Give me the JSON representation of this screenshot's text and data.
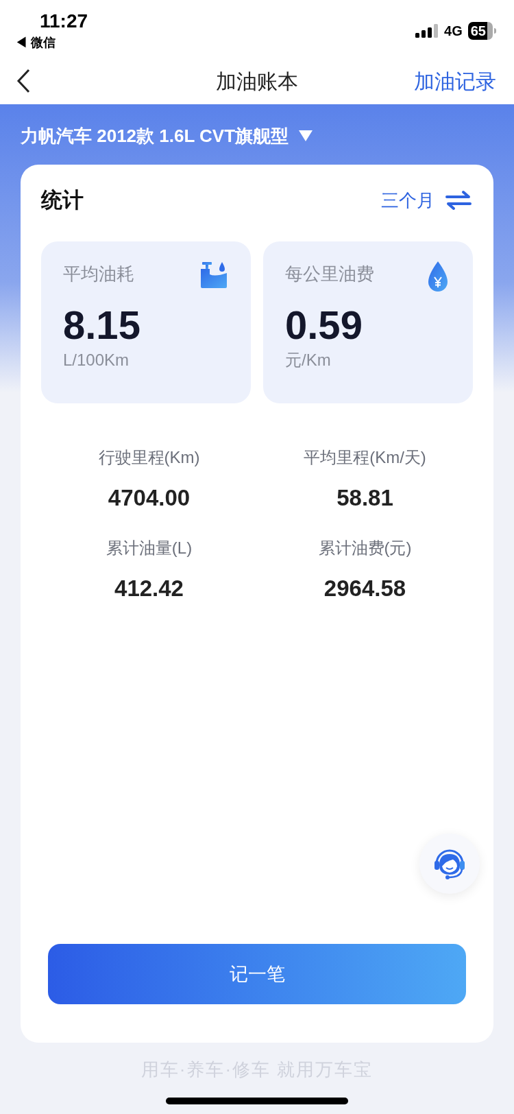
{
  "status_bar": {
    "time": "11:27",
    "back_app": "◀ 微信",
    "network": "4G",
    "battery": "65"
  },
  "nav": {
    "title": "加油账本",
    "action": "加油记录"
  },
  "car_selector": {
    "label": "力帆汽车 2012款 1.6L CVT旗舰型"
  },
  "stats": {
    "title": "统计",
    "period": "三个月",
    "highlights": [
      {
        "kind": "tank",
        "label": "平均油耗",
        "value": "8.15",
        "unit": "L/100Km"
      },
      {
        "kind": "drop",
        "label": "每公里油费",
        "value": "0.59",
        "unit": "元/Km"
      }
    ],
    "metrics": [
      {
        "label": "行驶里程(Km)",
        "value": "4704.00"
      },
      {
        "label": "平均里程(Km/天)",
        "value": "58.81"
      },
      {
        "label": "累计油量(L)",
        "value": "412.42"
      },
      {
        "label": "累计油费(元)",
        "value": "2964.58"
      }
    ],
    "record_button": "记一笔"
  },
  "footer": "用车·养车·修车 就用万车宝"
}
